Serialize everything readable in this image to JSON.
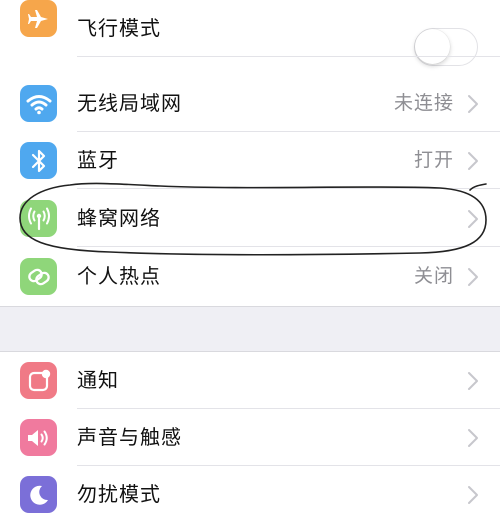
{
  "colors": {
    "airplane": "#f6a64b",
    "wifi": "#4fa8ef",
    "bluetooth": "#4fa8ef",
    "cellular": "#8fd67a",
    "hotspot": "#8fd67a",
    "notifications": "#f07a86",
    "sounds": "#f07a9e",
    "do_not_disturb": "#7b6fd8"
  },
  "settings_group_1": [
    {
      "label": "飞行模式",
      "icon": "airplane-icon",
      "toggle": false
    },
    {
      "label": "无线局域网",
      "icon": "wifi-icon",
      "value": "未连接"
    },
    {
      "label": "蓝牙",
      "icon": "bluetooth-icon",
      "value": "打开"
    },
    {
      "label": "蜂窝网络",
      "icon": "antenna-icon",
      "value": ""
    },
    {
      "label": "个人热点",
      "icon": "link-icon",
      "value": "关闭"
    }
  ],
  "settings_group_2": [
    {
      "label": "通知",
      "icon": "notification-icon"
    },
    {
      "label": "声音与触感",
      "icon": "speaker-icon"
    },
    {
      "label": "勿扰模式",
      "icon": "moon-icon"
    }
  ]
}
